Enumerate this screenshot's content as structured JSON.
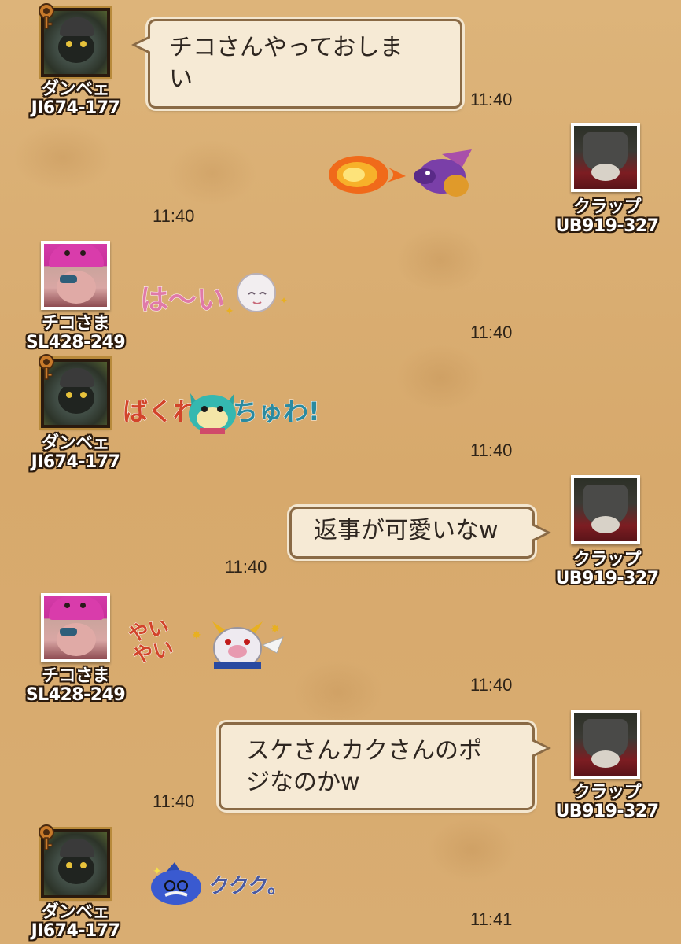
{
  "messages": [
    {
      "sender": {
        "name": "ダンベェ",
        "id": "JI674-177",
        "avatar_icon": "hooded-monster-avatar-icon"
      },
      "side": "left",
      "type": "text",
      "text": "チコさんやっておしま\nい",
      "time": "11:40"
    },
    {
      "sender": {
        "name": "クラップ",
        "id": "UB919-327",
        "avatar_icon": "bucket-hat-avatar-icon"
      },
      "side": "right",
      "type": "stamp",
      "stamp_icon": "fire-breathing-dragon-stamp-icon",
      "time": "11:40"
    },
    {
      "sender": {
        "name": "チコさま",
        "id": "SL428-249",
        "avatar_icon": "slime-hat-avatar-icon"
      },
      "side": "left",
      "type": "stamp",
      "stamp_icon": "white-haired-girl-stamp-icon",
      "stamp_text": "は〜い",
      "time": "11:40"
    },
    {
      "sender": {
        "name": "ダンベェ",
        "id": "JI674-177",
        "avatar_icon": "hooded-monster-avatar-icon"
      },
      "side": "left",
      "type": "stamp",
      "stamp_icon": "cat-monster-stamp-icon",
      "stamp_text_left": "ばくれ",
      "stamp_text_right": "ちゅわ!",
      "time": "11:40"
    },
    {
      "sender": {
        "name": "クラップ",
        "id": "UB919-327",
        "avatar_icon": "bucket-hat-avatar-icon"
      },
      "side": "right",
      "type": "text",
      "text": "返事が可愛いなw",
      "time": "11:40"
    },
    {
      "sender": {
        "name": "チコさま",
        "id": "SL428-249",
        "avatar_icon": "slime-hat-avatar-icon"
      },
      "side": "left",
      "type": "stamp",
      "stamp_icon": "horned-pig-monster-stamp-icon",
      "stamp_text": "やい\nやい",
      "time": "11:40"
    },
    {
      "sender": {
        "name": "クラップ",
        "id": "UB919-327",
        "avatar_icon": "bucket-hat-avatar-icon"
      },
      "side": "right",
      "type": "text",
      "text": "スケさんカクさんのポ\nジなのかw",
      "time": "11:40"
    },
    {
      "sender": {
        "name": "ダンベェ",
        "id": "JI674-177",
        "avatar_icon": "hooded-monster-avatar-icon"
      },
      "side": "left",
      "type": "stamp",
      "stamp_icon": "blue-mustache-monster-stamp-icon",
      "stamp_text": "ククク。",
      "time": "11:41"
    }
  ],
  "colors": {
    "background": "#d9ad72",
    "bubble_fill": "#f6ead5",
    "bubble_border": "#8a6a45",
    "name_outline": "#2b1a0c"
  },
  "icons": {
    "leader_key_badge": "key-badge-icon"
  }
}
